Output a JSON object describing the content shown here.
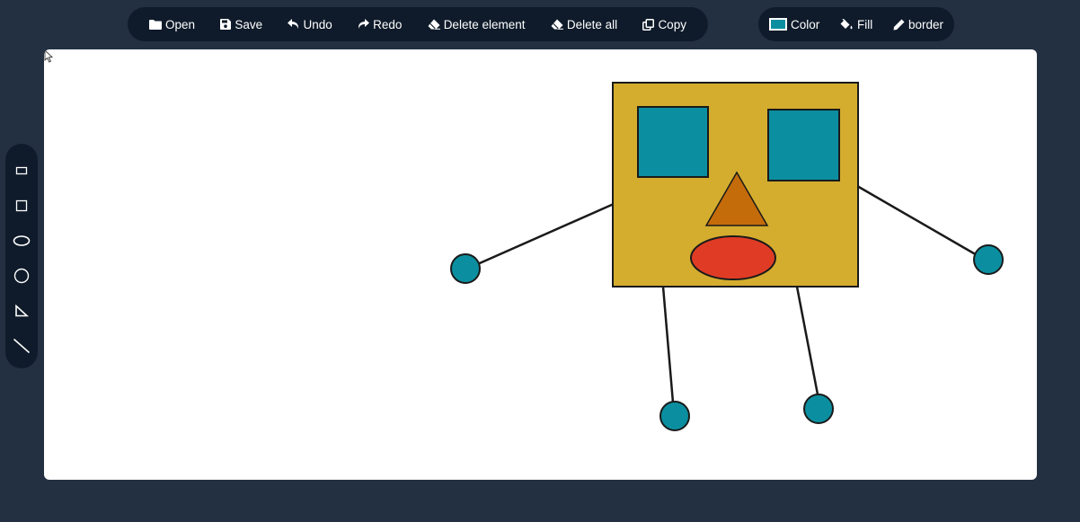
{
  "toolbar": {
    "open": "Open",
    "save": "Save",
    "undo": "Undo",
    "redo": "Redo",
    "delete_element": "Delete element",
    "delete_all": "Delete all",
    "copy": "Copy"
  },
  "style_toolbar": {
    "color": "Color",
    "fill": "Fill",
    "border": "border",
    "color_swatch": "#0b8fa0"
  },
  "side_tools": [
    "rectangle-tool",
    "square-tool",
    "ellipse-tool",
    "circle-tool",
    "triangle-tool",
    "line-tool"
  ],
  "colors": {
    "body_fill": "#d4ad2f",
    "eye_fill": "#0b8fa0",
    "nose_fill": "#c46b0a",
    "mouth_fill": "#e03c25",
    "hand_fill": "#0b8fa0",
    "stroke": "#1a1a1a"
  }
}
